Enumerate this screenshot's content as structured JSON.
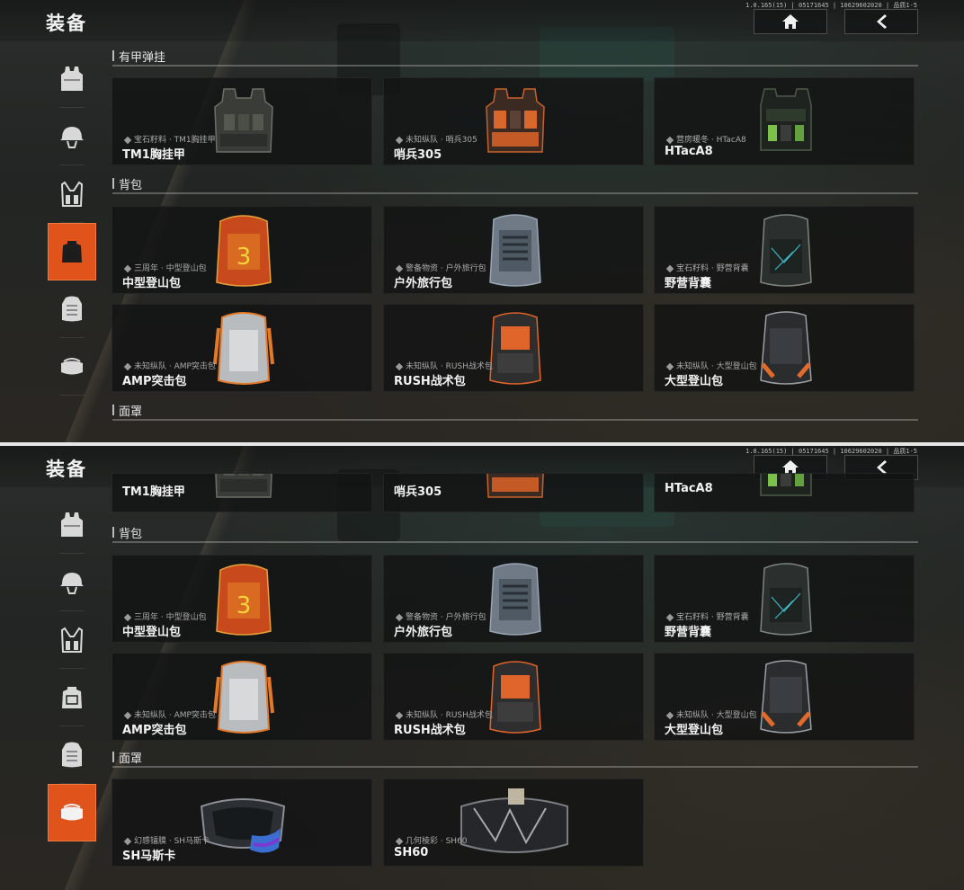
{
  "app": {
    "title": "装备",
    "version": "1.0.165(15) | 05171645 | 10629602020 | 品质1-5",
    "home_icon": "home-icon",
    "back_icon": "back-arrow-icon",
    "accent_color": "#e0541b"
  },
  "sidebar": [
    {
      "icon": "vest-icon"
    },
    {
      "icon": "helmet-icon"
    },
    {
      "icon": "chest-rig-icon"
    },
    {
      "icon": "backpack-icon"
    },
    {
      "icon": "large-backpack-icon"
    },
    {
      "icon": "mask-icon"
    }
  ],
  "top": {
    "sections": {
      "rig": "有甲弹挂",
      "bag": "背包",
      "mask": "面罩"
    },
    "rig_items": [
      {
        "sub": "宝石籽料 · TM1胸挂甲",
        "name": "TM1胸挂甲"
      },
      {
        "sub": "未知纵队 · 哨兵305",
        "name": "哨兵305"
      },
      {
        "sub": "营房暖冬 · HTacA8",
        "name": "HTacA8"
      }
    ],
    "bag_items": [
      {
        "sub": "三周年 · 中型登山包",
        "name": "中型登山包"
      },
      {
        "sub": "警备物资 · 户外旅行包",
        "name": "户外旅行包"
      },
      {
        "sub": "宝石籽料 · 野营背囊",
        "name": "野营背囊"
      },
      {
        "sub": "未知纵队 · AMP突击包",
        "name": "AMP突击包"
      },
      {
        "sub": "未知纵队 · RUSH战术包",
        "name": "RUSH战术包"
      },
      {
        "sub": "未知纵队 · 大型登山包",
        "name": "大型登山包"
      }
    ]
  },
  "bottom": {
    "sections": {
      "bag": "背包",
      "mask": "面罩"
    },
    "rig_names": [
      "TM1胸挂甲",
      "哨兵305",
      "HTacA8"
    ],
    "bag_items": [
      {
        "sub": "三周年 · 中型登山包",
        "name": "中型登山包"
      },
      {
        "sub": "警备物资 · 户外旅行包",
        "name": "户外旅行包"
      },
      {
        "sub": "宝石籽料 · 野营背囊",
        "name": "野营背囊"
      },
      {
        "sub": "未知纵队 · AMP突击包",
        "name": "AMP突击包"
      },
      {
        "sub": "未知纵队 · RUSH战术包",
        "name": "RUSH战术包"
      },
      {
        "sub": "未知纵队 · 大型登山包",
        "name": "大型登山包"
      }
    ],
    "mask_items": [
      {
        "sub": "幻感镭膜 · SH马斯卡",
        "name": "SH马斯卡"
      },
      {
        "sub": "几何棱彩 · SH60",
        "name": "SH60"
      }
    ]
  }
}
